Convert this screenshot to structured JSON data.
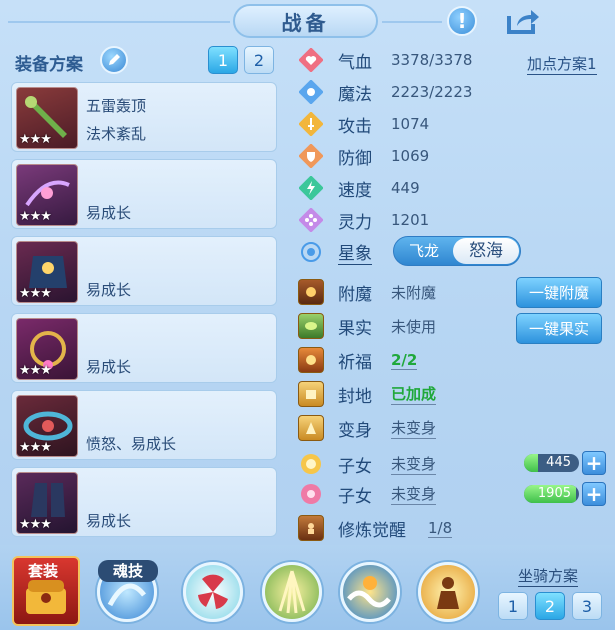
{
  "header": {
    "title": "战备"
  },
  "left": {
    "scheme_label": "装备方案",
    "scheme_tabs": [
      "1",
      "2"
    ],
    "items": [
      {
        "lines": [
          "五雷轰顶",
          "法术紊乱"
        ],
        "stars": "★★★"
      },
      {
        "lines": [
          "易成长"
        ],
        "stars": "★★★"
      },
      {
        "lines": [
          "易成长"
        ],
        "stars": "★★★"
      },
      {
        "lines": [
          "易成长"
        ],
        "stars": "★★★"
      },
      {
        "lines": [
          "愤怒、易成长"
        ],
        "stars": "★★★"
      },
      {
        "lines": [
          "易成长"
        ],
        "stars": "★★★"
      }
    ]
  },
  "stats": {
    "addpoint_label": "加点方案1",
    "rows": [
      {
        "name": "气血",
        "value": "3378/3378",
        "icon": "heart-icon"
      },
      {
        "name": "魔法",
        "value": "2223/2223",
        "icon": "magic-icon"
      },
      {
        "name": "攻击",
        "value": "1074",
        "icon": "sword-icon"
      },
      {
        "name": "防御",
        "value": "1069",
        "icon": "shield-icon"
      },
      {
        "name": "速度",
        "value": "449",
        "icon": "speed-icon"
      },
      {
        "name": "灵力",
        "value": "1201",
        "icon": "spirit-icon"
      }
    ],
    "star": {
      "name": "星象",
      "options": [
        "飞龙",
        "怒海"
      ],
      "selected": "怒海"
    }
  },
  "extras": {
    "rows": [
      {
        "name": "附魔",
        "value": "未附魔"
      },
      {
        "name": "果实",
        "value": "未使用"
      },
      {
        "name": "祈福",
        "value": "2/2"
      },
      {
        "name": "封地",
        "value": "已加成"
      },
      {
        "name": "变身",
        "value": "未变身"
      },
      {
        "name": "子女",
        "value": "未变身"
      },
      {
        "name": "子女",
        "value": "未变身"
      },
      {
        "name": "修炼觉醒",
        "value": "1/8"
      }
    ],
    "btn_enchant": "一键附魔",
    "btn_fruit": "一键果实",
    "child1_value": "445",
    "child1_fill": 0.25,
    "child2_value": "1905",
    "child2_fill": 0.95
  },
  "bottom": {
    "suit_label": "套装",
    "soul_label": "魂技",
    "mount_label": "坐骑方案",
    "mount_tabs": [
      "1",
      "2",
      "3"
    ],
    "mount_selected": "2"
  },
  "colors": {
    "accent": "#2ba7e6",
    "green": "#20a83b",
    "panel": "#b7d6f3"
  }
}
